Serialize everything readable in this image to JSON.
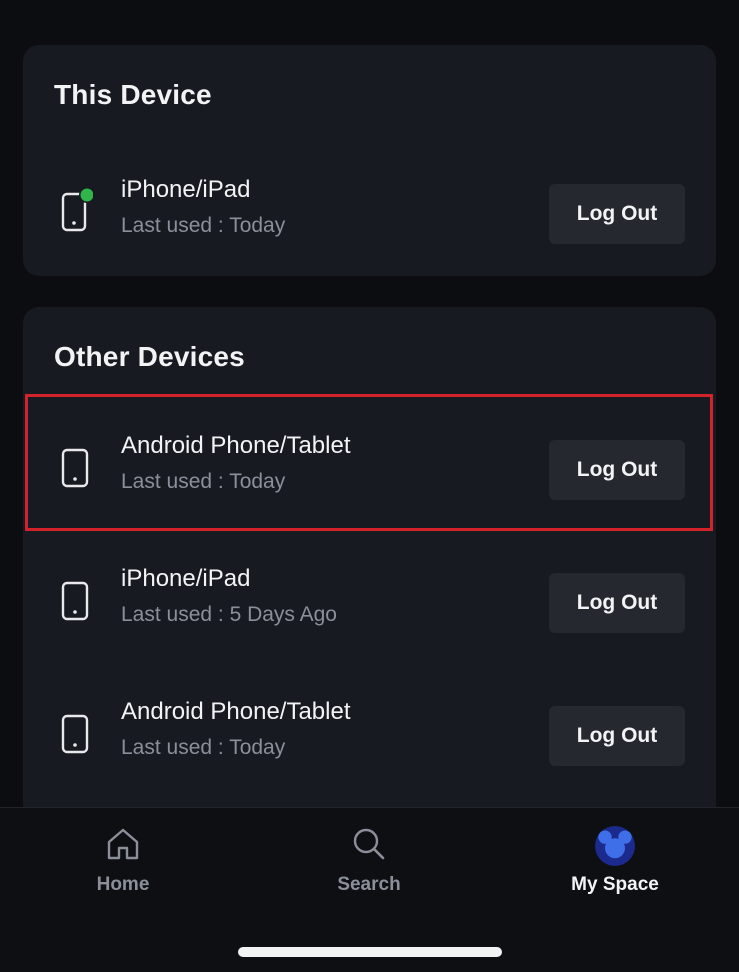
{
  "this_device": {
    "title": "This Device",
    "device": {
      "name": "iPhone/iPad",
      "last_used": "Last used : Today",
      "status_color": "#2fb54a",
      "icon": "phone-icon"
    },
    "logout_label": "Log Out"
  },
  "other_devices": {
    "title": "Other Devices",
    "items": [
      {
        "name": "Android Phone/Tablet",
        "last_used": "Last used : Today",
        "icon": "phone-icon",
        "logout_label": "Log Out",
        "highlighted": true
      },
      {
        "name": "iPhone/iPad",
        "last_used": "Last used : 5 Days Ago",
        "icon": "phone-icon",
        "logout_label": "Log Out"
      },
      {
        "name": "Android Phone/Tablet",
        "last_used": "Last used : Today",
        "icon": "phone-icon",
        "logout_label": "Log Out"
      }
    ]
  },
  "highlight_color": "#d3232a",
  "tabbar": {
    "tabs": [
      {
        "label": "Home",
        "icon": "home-icon",
        "active": false
      },
      {
        "label": "Search",
        "icon": "search-icon",
        "active": false
      },
      {
        "label": "My Space",
        "icon": "avatar-icon",
        "active": true
      }
    ]
  }
}
